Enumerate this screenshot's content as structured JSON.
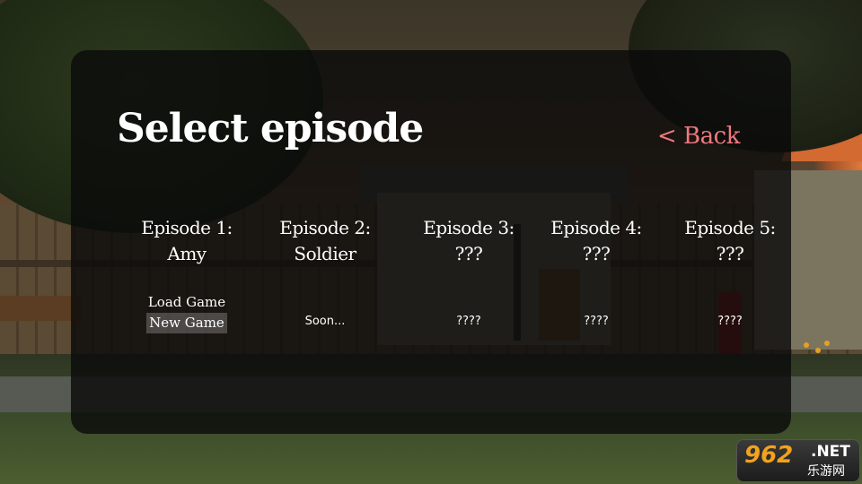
{
  "menu": {
    "title": "Select episode",
    "back_label": "< Back",
    "episodes": [
      {
        "title_line1": "Episode 1:",
        "title_line2": "Amy",
        "actions": [
          "Load Game",
          "New Game"
        ],
        "selected_action": "New Game"
      },
      {
        "title_line1": "Episode 2:",
        "title_line2": "Soldier",
        "status": "Soon..."
      },
      {
        "title_line1": "Episode 3:",
        "title_line2": "???",
        "status": "????"
      },
      {
        "title_line1": "Episode 4:",
        "title_line2": "???",
        "status": "????"
      },
      {
        "title_line1": "Episode 5:",
        "title_line2": "???",
        "status": "????"
      }
    ]
  },
  "watermark": {
    "number": "962",
    "suffix": ".NET",
    "subtitle": "乐游网"
  },
  "colors": {
    "back_link": "#f07880",
    "panel_bg": "rgba(10,10,10,0.80)",
    "text": "#ffffff"
  }
}
